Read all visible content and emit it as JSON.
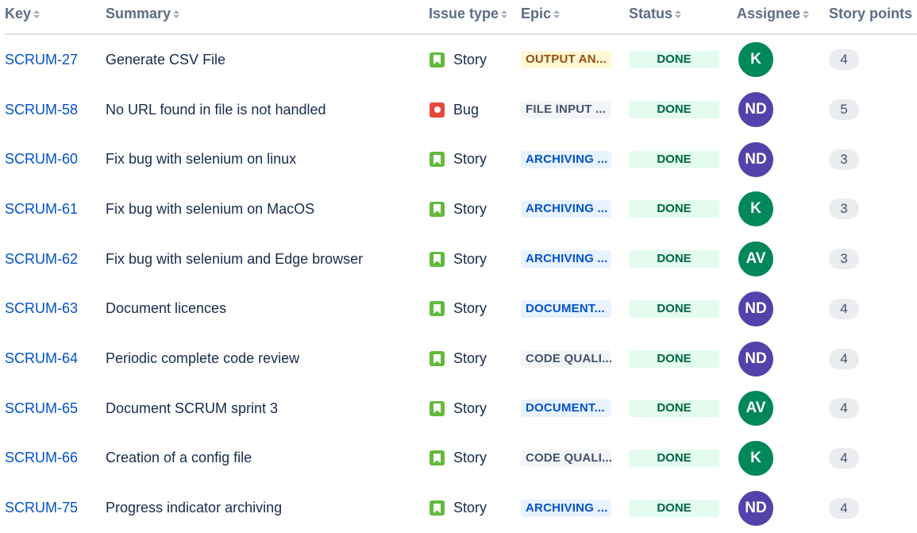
{
  "columns": {
    "key": "Key",
    "summary": "Summary",
    "issue_type": "Issue type",
    "epic": "Epic",
    "status": "Status",
    "assignee": "Assignee",
    "story_points": "Story points"
  },
  "rows": [
    {
      "key": "SCRUM-27",
      "summary": "Generate CSV File",
      "type": "Story",
      "epic": "OUTPUT AN...",
      "epic_bg": "#FFF7D6",
      "epic_fg": "#974F0C",
      "status": "DONE",
      "assignee": "K",
      "assignee_color": "#00875A",
      "points": "4"
    },
    {
      "key": "SCRUM-58",
      "summary": "No URL found in file is not handled",
      "type": "Bug",
      "epic": "FILE INPUT ...",
      "epic_bg": "#F4F5F7",
      "epic_fg": "#42526E",
      "status": "DONE",
      "assignee": "ND",
      "assignee_color": "#5243AA",
      "points": "5"
    },
    {
      "key": "SCRUM-60",
      "summary": "Fix bug with selenium on linux",
      "type": "Story",
      "epic": "ARCHIVING ...",
      "epic_bg": "#E9F2FF",
      "epic_fg": "#0052CC",
      "status": "DONE",
      "assignee": "ND",
      "assignee_color": "#5243AA",
      "points": "3"
    },
    {
      "key": "SCRUM-61",
      "summary": "Fix bug with selenium on MacOS",
      "type": "Story",
      "epic": "ARCHIVING ...",
      "epic_bg": "#E9F2FF",
      "epic_fg": "#0052CC",
      "status": "DONE",
      "assignee": "K",
      "assignee_color": "#00875A",
      "points": "3"
    },
    {
      "key": "SCRUM-62",
      "summary": "Fix bug with selenium and Edge browser",
      "type": "Story",
      "epic": "ARCHIVING ...",
      "epic_bg": "#E9F2FF",
      "epic_fg": "#0052CC",
      "status": "DONE",
      "assignee": "AV",
      "assignee_color": "#00875A",
      "points": "3"
    },
    {
      "key": "SCRUM-63",
      "summary": "Document licences",
      "type": "Story",
      "epic": "DOCUMENT...",
      "epic_bg": "#E9F2FF",
      "epic_fg": "#0052CC",
      "status": "DONE",
      "assignee": "ND",
      "assignee_color": "#5243AA",
      "points": "4"
    },
    {
      "key": "SCRUM-64",
      "summary": "Periodic complete code review",
      "type": "Story",
      "epic": "CODE QUALI...",
      "epic_bg": "#F4F5F7",
      "epic_fg": "#42526E",
      "status": "DONE",
      "assignee": "ND",
      "assignee_color": "#5243AA",
      "points": "4"
    },
    {
      "key": "SCRUM-65",
      "summary": "Document SCRUM sprint 3",
      "type": "Story",
      "epic": "DOCUMENT...",
      "epic_bg": "#E9F2FF",
      "epic_fg": "#0052CC",
      "status": "DONE",
      "assignee": "AV",
      "assignee_color": "#00875A",
      "points": "4"
    },
    {
      "key": "SCRUM-66",
      "summary": "Creation of a config file",
      "type": "Story",
      "epic": "CODE QUALI...",
      "epic_bg": "#F4F5F7",
      "epic_fg": "#42526E",
      "status": "DONE",
      "assignee": "K",
      "assignee_color": "#00875A",
      "points": "4"
    },
    {
      "key": "SCRUM-75",
      "summary": "Progress indicator archiving",
      "type": "Story",
      "epic": "ARCHIVING ...",
      "epic_bg": "#E9F2FF",
      "epic_fg": "#0052CC",
      "status": "DONE",
      "assignee": "ND",
      "assignee_color": "#5243AA",
      "points": "4"
    }
  ],
  "icons": {
    "story": "story-icon",
    "bug": "bug-icon",
    "sort": "sort-icon"
  }
}
